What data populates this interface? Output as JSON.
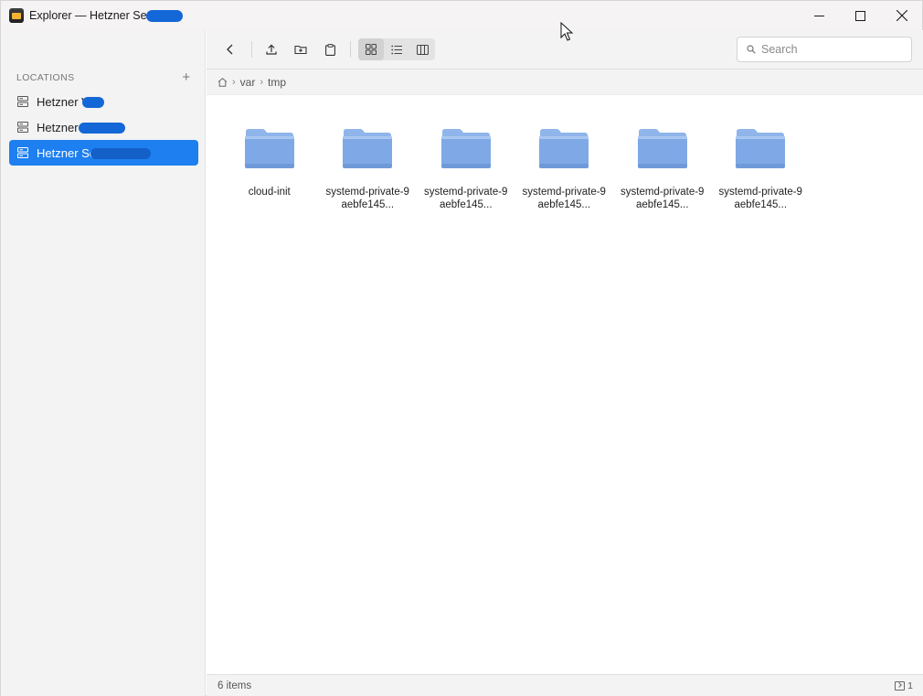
{
  "window": {
    "title": "Explorer — Hetzner Sem"
  },
  "sidebar": {
    "section_label": "LOCATIONS",
    "add_symbol": "+",
    "items": [
      {
        "label": "Hetzner V",
        "active": false
      },
      {
        "label": "Hetzner ",
        "active": false
      },
      {
        "label": "Hetzner Sem",
        "active": true
      }
    ]
  },
  "toolbar": {
    "buttons": [
      "back-icon",
      "upload-icon",
      "new-folder-icon",
      "clipboard-icon"
    ],
    "views": [
      {
        "icon": "grid-view-icon",
        "active": true
      },
      {
        "icon": "list-view-icon",
        "active": false
      },
      {
        "icon": "columns-view-icon",
        "active": false
      }
    ]
  },
  "search": {
    "placeholder": "Search",
    "value": ""
  },
  "breadcrumb": {
    "home_icon": "home-icon",
    "segments": [
      "var",
      "tmp"
    ]
  },
  "files": [
    {
      "name": "cloud-init"
    },
    {
      "name": "systemd-private-9aebfe145..."
    },
    {
      "name": "systemd-private-9aebfe145..."
    },
    {
      "name": "systemd-private-9aebfe145..."
    },
    {
      "name": "systemd-private-9aebfe145..."
    },
    {
      "name": "systemd-private-9aebfe145..."
    }
  ],
  "status": {
    "item_count": "6 items",
    "terminal_count": "1"
  },
  "colors": {
    "accent": "#1d7ff0",
    "folder": "#7fa9e6",
    "sidebar_bg": "#f3f3f3"
  }
}
